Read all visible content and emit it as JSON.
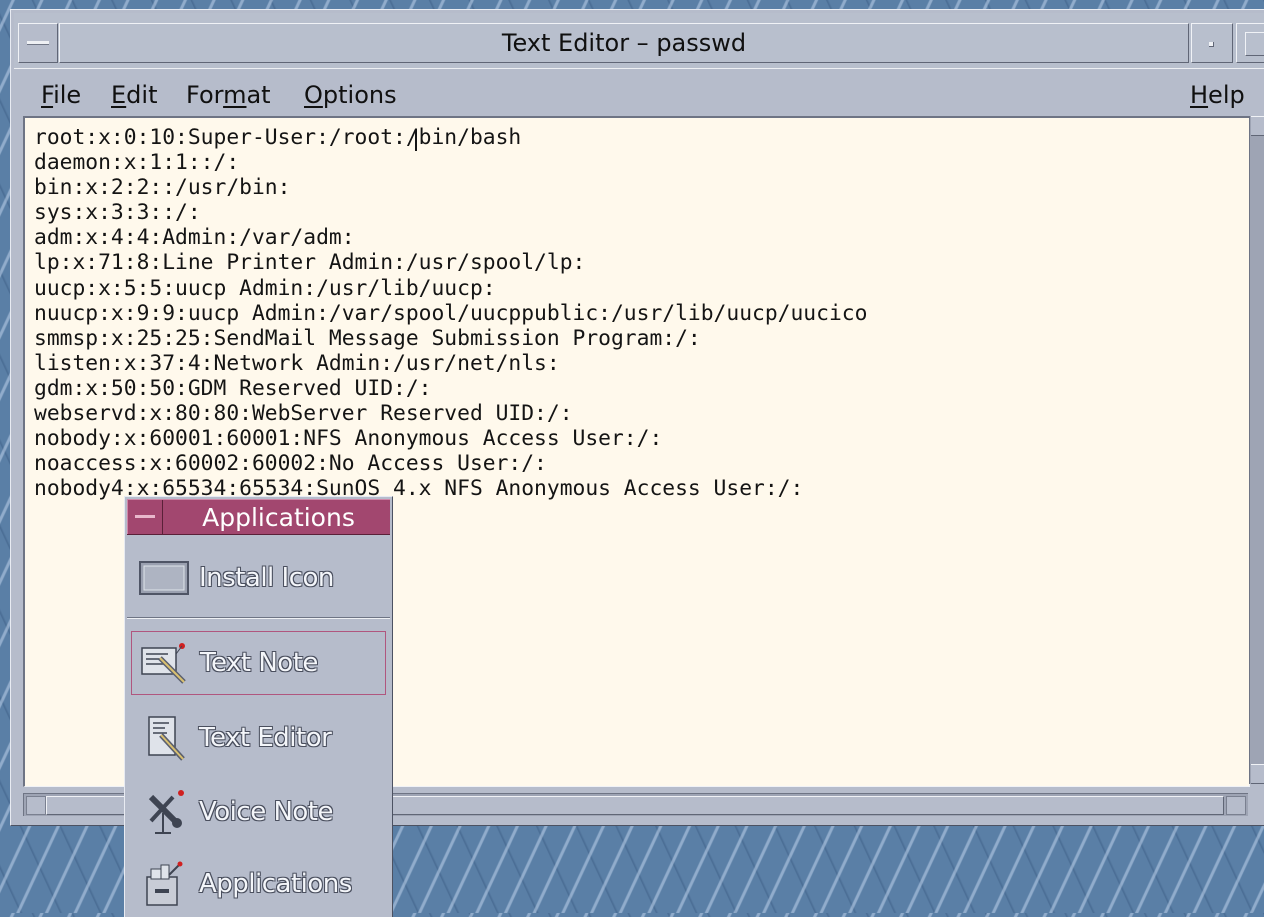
{
  "window": {
    "title": "Text Editor – passwd"
  },
  "menubar": {
    "file": {
      "pre": "",
      "mnemonic": "F",
      "post": "ile"
    },
    "edit": {
      "pre": "",
      "mnemonic": "E",
      "post": "dit"
    },
    "format": {
      "pre": "For",
      "mnemonic": "m",
      "post": "at"
    },
    "options": {
      "pre": "",
      "mnemonic": "O",
      "post": "ptions"
    },
    "help": {
      "pre": "",
      "mnemonic": "H",
      "post": "elp"
    }
  },
  "document": {
    "lines": [
      "root:x:0:10:Super-User:/root:/bin/bash",
      "daemon:x:1:1::/:",
      "bin:x:2:2::/usr/bin:",
      "sys:x:3:3::/:",
      "adm:x:4:4:Admin:/var/adm:",
      "lp:x:71:8:Line Printer Admin:/usr/spool/lp:",
      "uucp:x:5:5:uucp Admin:/usr/lib/uucp:",
      "nuucp:x:9:9:uucp Admin:/var/spool/uucppublic:/usr/lib/uucp/uucico",
      "smmsp:x:25:25:SendMail Message Submission Program:/:",
      "listen:x:37:4:Network Admin:/usr/net/nls:",
      "gdm:x:50:50:GDM Reserved UID:/:",
      "webservd:x:80:80:WebServer Reserved UID:/:",
      "nobody:x:60001:60001:NFS Anonymous Access User:/:",
      "noaccess:x:60002:60002:No Access User:/:",
      "nobody4:x:65534:65534:SunOS 4.x NFS Anonymous Access User:/:"
    ]
  },
  "subpanel": {
    "title": "Applications",
    "items": [
      {
        "label": "Install Icon",
        "icon": "install-drop-zone-icon"
      },
      {
        "label": "Text Note",
        "icon": "text-note-icon"
      },
      {
        "label": "Text Editor",
        "icon": "text-editor-icon"
      },
      {
        "label": "Voice Note",
        "icon": "voice-note-icon"
      },
      {
        "label": "Applications",
        "icon": "applications-folder-icon"
      }
    ]
  },
  "colors": {
    "subpanel_title": "#a2476f",
    "text_area_bg": "#fff9ec",
    "window_frame": "#b6bccb"
  }
}
